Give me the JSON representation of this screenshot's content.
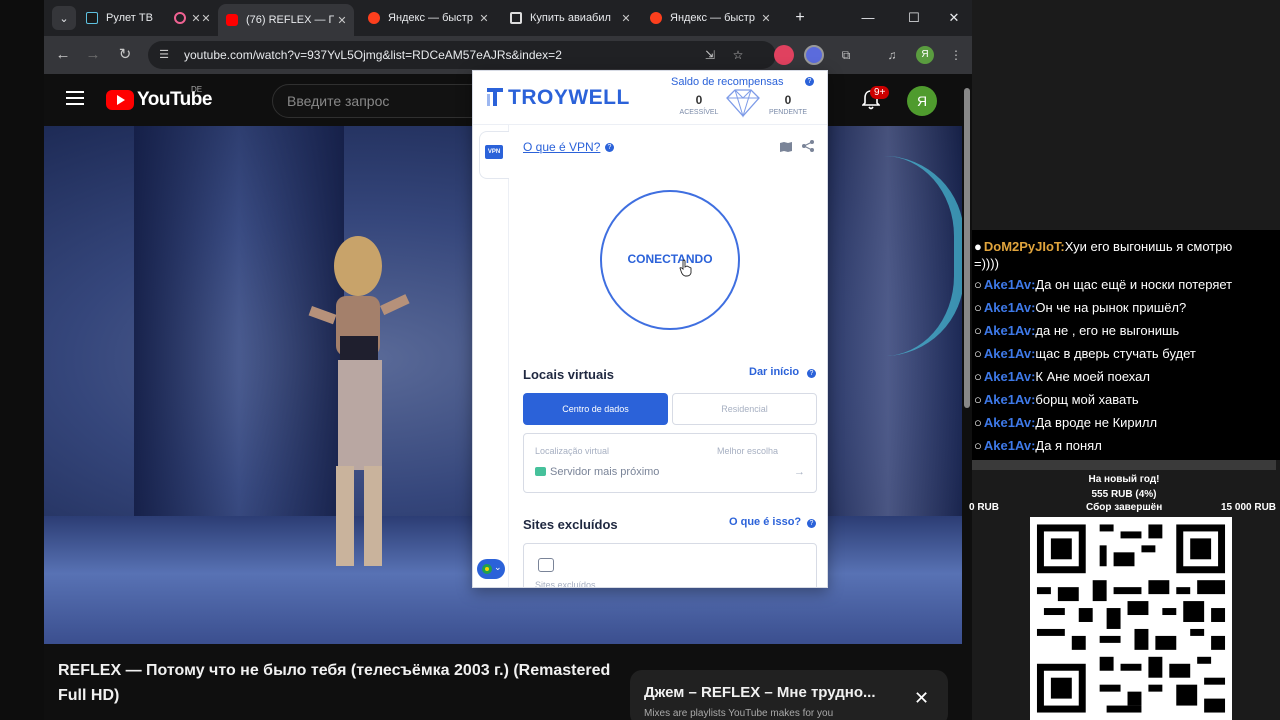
{
  "browser": {
    "tabs": [
      {
        "title": "Рулет ТВ",
        "active": false
      },
      {
        "title": "",
        "active": false
      },
      {
        "title": "(76) REFLEX — П",
        "active": true
      },
      {
        "title": "Яндекс — быстр",
        "active": false
      },
      {
        "title": "Купить авиабил",
        "active": false
      },
      {
        "title": "Яндекс — быстр",
        "active": false
      }
    ],
    "url": "youtube.com/watch?v=937YvL5Ojmg&list=RDCeAM57eAJRs&index=2",
    "profile_initial": "Я"
  },
  "youtube": {
    "logo_text": "YouTube",
    "region": "DE",
    "search_placeholder": "Введите запрос",
    "notifications_badge": "9+",
    "avatar_initial": "Я",
    "video_title": "REFLEX — Потому что не было тебя (телесъёмка 2003 г.) (Remastered Full HD)",
    "mix": {
      "title": "Джем – REFLEX – Мне трудно...",
      "subtitle": "Mixes are playlists YouTube makes for you",
      "close": "✕"
    }
  },
  "vpn": {
    "brand": "TROYWELL",
    "rewards_title": "Saldo de recompensas",
    "accessible_value": "0",
    "accessible_label": "ACESSÍVEL",
    "pending_value": "0",
    "pending_label": "PENDENTE",
    "side_tab": "VPN",
    "what_is_vpn": "O que é VPN?",
    "status": "CONECTANDO",
    "virtual_locations_title": "Locais virtuais",
    "start_link": "Dar início",
    "segment_datacenter": "Centro de dados",
    "segment_residential": "Residencial",
    "location_label": "Localização virtual",
    "best_choice": "Melhor escolha",
    "location_value": "Servidor mais próximo",
    "excluded_sites_title": "Sites excluídos",
    "what_is_this": "O que é isso?",
    "excluded_sites_label": "Sites excluídos",
    "accent": "#2b62d9"
  },
  "chat": {
    "messages": [
      {
        "user": "DoM2PyJIoT:",
        "text": "Хуи его выгонишь я смотрю",
        "cont": "=))))"
      },
      {
        "user": "Ake1Av:",
        "text": "Да он щас ещё и носки потеряет"
      },
      {
        "user": "Ake1Av:",
        "text": "Он че на рынок пришёл?"
      },
      {
        "user": "Ake1Av:",
        "text": "да не , его не выгонишь"
      },
      {
        "user": "Ake1Av:",
        "text": "щас в дверь стучать будет"
      },
      {
        "user": "Ake1Av:",
        "text": "К Ане моей поехал"
      },
      {
        "user": "Ake1Av:",
        "text": "борщ мой хавать"
      },
      {
        "user": "Ake1Av:",
        "text": "Да вроде не Кирилл"
      },
      {
        "user": "Ake1Av:",
        "text": "Да я понял"
      }
    ]
  },
  "donation": {
    "title": "На новый год!",
    "amount": "555 RUB (4%)",
    "min": "0 RUB",
    "status": "Сбор завершён",
    "goal": "15 000 RUB"
  }
}
